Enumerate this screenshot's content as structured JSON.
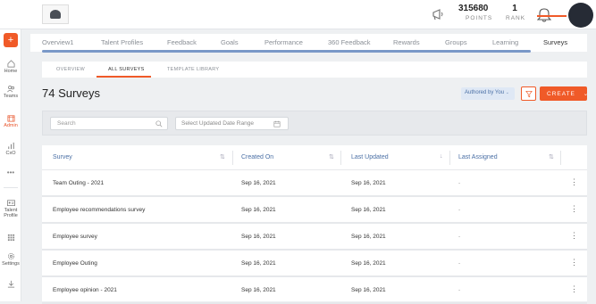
{
  "header": {
    "points_value": "315680",
    "points_label": "POINTS",
    "rank_value": "1",
    "rank_label": "RANK"
  },
  "sidebar": {
    "items": [
      {
        "label": "Home",
        "icon": "home-icon"
      },
      {
        "label": "Teams",
        "icon": "teams-icon"
      },
      {
        "label": "Admin",
        "icon": "admin-icon"
      },
      {
        "label": "CxO",
        "icon": "chart-icon"
      },
      {
        "label": "Talent Profile",
        "icon": "id-card-icon"
      },
      {
        "label": "Settings",
        "icon": "gear-icon"
      }
    ],
    "accent": "#f05a28"
  },
  "tabs": [
    "Overview1",
    "Talent Profiles",
    "Feedback",
    "Goals",
    "Performance",
    "360 Feedback",
    "Rewards",
    "Groups",
    "Learning",
    "Surveys"
  ],
  "active_tab": "Surveys",
  "subtabs": [
    "OVERVIEW",
    "ALL SURVEYS",
    "TEMPLATE LIBRARY"
  ],
  "active_subtab": "ALL SURVEYS",
  "page": {
    "title": "74 Surveys",
    "authored_label": "Authored by You",
    "create_label": "CREATE"
  },
  "filters": {
    "search_placeholder": "Search",
    "date_placeholder": "Select Updated Date Range"
  },
  "table": {
    "columns": [
      "Survey",
      "Created On",
      "Last Updated",
      "Last Assigned"
    ],
    "rows": [
      {
        "survey": "Team Outing - 2021",
        "created": "Sep 16, 2021",
        "updated": "Sep 16, 2021",
        "assigned": "-"
      },
      {
        "survey": "Employee recommendations survey",
        "created": "Sep 16, 2021",
        "updated": "Sep 16, 2021",
        "assigned": "-"
      },
      {
        "survey": "Employee survey",
        "created": "Sep 16, 2021",
        "updated": "Sep 16, 2021",
        "assigned": "-"
      },
      {
        "survey": "Employee Outing",
        "created": "Sep 16, 2021",
        "updated": "Sep 16, 2021",
        "assigned": "-"
      },
      {
        "survey": "Employee opinion - 2021",
        "created": "Sep 16, 2021",
        "updated": "Sep 16, 2021",
        "assigned": "-"
      }
    ]
  },
  "colors": {
    "accent": "#f05a28",
    "link_blue": "#4a6fa5"
  }
}
